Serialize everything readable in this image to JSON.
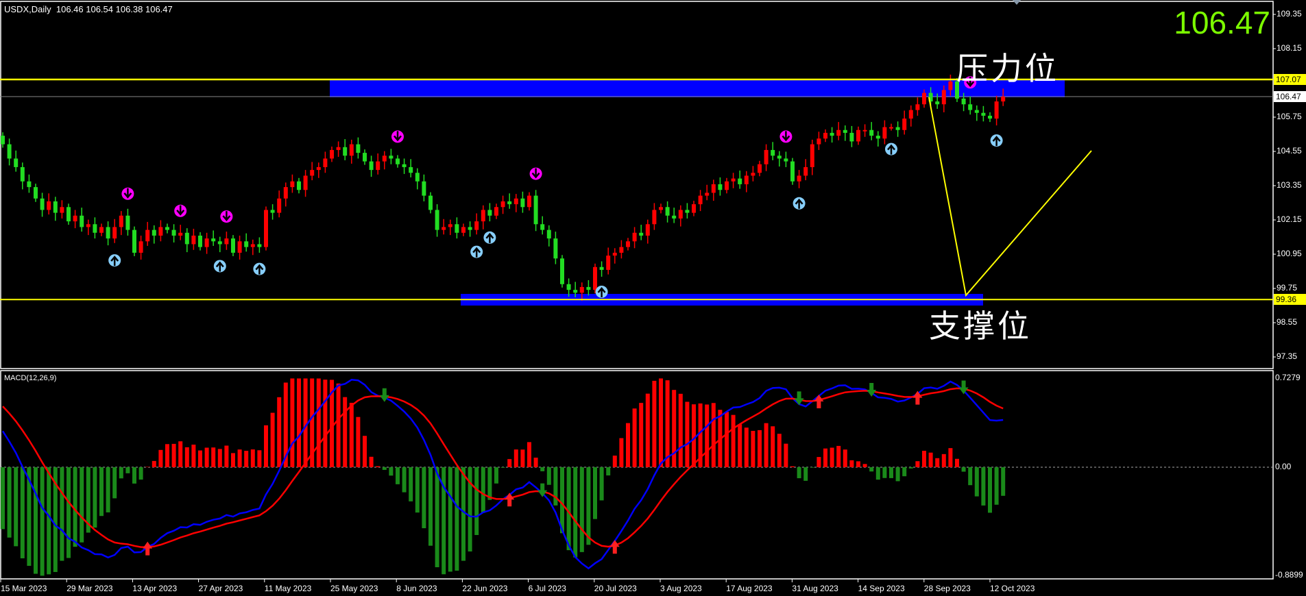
{
  "header": {
    "symbol": "USDX,Daily",
    "ohlc": "106.46 106.54 106.38 106.47",
    "big_price": "106.47"
  },
  "annotations": {
    "resistance_label": "压力位",
    "support_label": "支撑位"
  },
  "colors": {
    "bull": "#ff0000",
    "bear": "#22dd22",
    "level": "#ffff00",
    "zone": "#0000ff",
    "macd": "#0000ff",
    "signal": "#ff0000"
  },
  "chart_data": [
    {
      "type": "candlestick",
      "title": "USDX,Daily",
      "ylim": [
        96.9,
        109.85
      ],
      "y_ticks": [
        "109.35",
        "108.15",
        "105.75",
        "104.55",
        "103.35",
        "102.15",
        "100.95",
        "99.75",
        "98.55",
        "97.35"
      ],
      "x_ticks": [
        "15 Mar 2023",
        "29 Mar 2023",
        "13 Apr 2023",
        "27 Apr 2023",
        "11 May 2023",
        "25 May 2023",
        "8 Jun 2023",
        "22 Jun 2023",
        "6 Jul 2023",
        "20 Jul 2023",
        "3 Aug 2023",
        "17 Aug 2023",
        "31 Aug 2023",
        "14 Sep 2023",
        "28 Sep 2023",
        "12 Oct 2023"
      ],
      "levels": {
        "resistance": 107.07,
        "support": 99.36,
        "current": 106.47
      },
      "level_labels": {
        "resistance": "107.07",
        "support": "99.36",
        "current": "106.47"
      },
      "close": [
        104.8,
        104.3,
        104.0,
        103.5,
        103.3,
        102.9,
        102.5,
        102.8,
        102.4,
        102.6,
        102.1,
        102.3,
        101.9,
        102.0,
        101.7,
        101.9,
        101.5,
        101.9,
        102.3,
        101.8,
        101.0,
        101.4,
        101.8,
        101.6,
        101.9,
        101.8,
        101.6,
        101.7,
        101.3,
        101.6,
        101.2,
        101.5,
        101.4,
        101.3,
        101.5,
        101.0,
        101.4,
        101.2,
        101.3,
        101.2,
        102.5,
        102.4,
        102.9,
        103.3,
        103.5,
        103.2,
        103.7,
        103.9,
        104.0,
        104.3,
        104.6,
        104.7,
        104.4,
        104.8,
        104.5,
        104.2,
        103.9,
        104.2,
        104.4,
        104.3,
        104.1,
        104.0,
        103.8,
        103.5,
        103.0,
        102.5,
        101.8,
        101.9,
        102.0,
        101.7,
        101.9,
        101.8,
        102.1,
        102.5,
        102.3,
        102.6,
        102.8,
        102.7,
        102.9,
        102.6,
        103.0,
        102.0,
        101.8,
        101.5,
        100.8,
        99.9,
        99.7,
        99.6,
        99.8,
        99.7,
        100.5,
        100.4,
        100.9,
        101.0,
        101.2,
        101.4,
        101.7,
        101.6,
        102.0,
        102.5,
        102.6,
        102.3,
        102.2,
        102.5,
        102.4,
        102.7,
        103.0,
        103.1,
        103.4,
        103.2,
        103.5,
        103.6,
        103.4,
        103.7,
        103.8,
        104.1,
        104.6,
        104.4,
        104.3,
        104.2,
        103.5,
        103.7,
        104.0,
        104.8,
        105.0,
        105.2,
        105.1,
        105.3,
        105.2,
        104.9,
        105.3,
        105.3,
        105.1,
        105.0,
        105.4,
        105.4,
        105.3,
        105.7,
        106.0,
        106.2,
        106.6,
        106.3,
        106.2,
        106.7,
        107.0,
        106.4,
        106.2,
        106.0,
        105.9,
        105.8,
        105.7,
        106.3,
        106.47
      ],
      "sell_signals": [
        19,
        27,
        34,
        60,
        81,
        119,
        147
      ],
      "buy_signals": [
        17,
        33,
        39,
        72,
        74,
        91,
        121,
        135,
        151
      ]
    },
    {
      "type": "macd",
      "title": "MACD(12,26,9)",
      "params": [
        12,
        26,
        9
      ],
      "ylim": [
        -0.8899,
        0.7279
      ],
      "y_ticks": [
        "0.7279",
        "0.00",
        "-0.8899"
      ]
    }
  ]
}
